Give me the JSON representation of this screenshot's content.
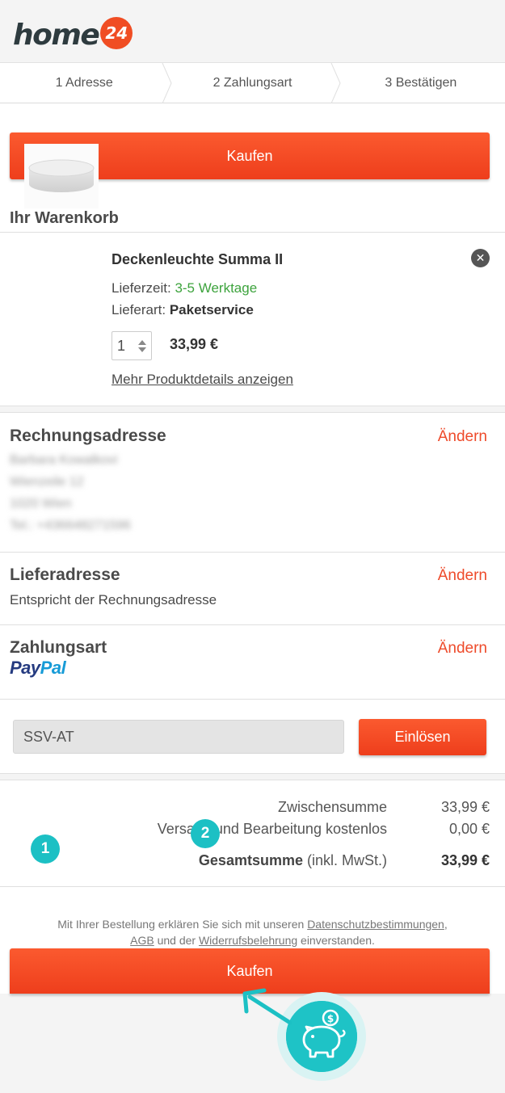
{
  "header": {
    "logo_text": "home",
    "logo_badge": "24"
  },
  "steps": [
    {
      "label": "1 Adresse"
    },
    {
      "label": "2 Zahlungsart"
    },
    {
      "label": "3 Bestätigen"
    }
  ],
  "buy_button_top": "Kaufen",
  "cart": {
    "title": "Ihr Warenkorb",
    "product_name": "Deckenleuchte Summa II",
    "delivery_time_label": "Lieferzeit:",
    "delivery_time_value": "3-5 Werktage",
    "delivery_type_label": "Lieferart:",
    "delivery_type_value": "Paketservice",
    "quantity": "1",
    "price": "33,99 €",
    "details_link": "Mehr Produktdetails anzeigen"
  },
  "billing": {
    "title": "Rechnungsadresse",
    "change_label": "Ändern",
    "lines": [
      "Barbara Kowalkovi",
      "Wienzeile 12",
      "1020 Wien",
      "Tel.: +436648271596"
    ]
  },
  "shipping": {
    "title": "Lieferadresse",
    "change_label": "Ändern",
    "text": "Entspricht der Rechnungsadresse"
  },
  "payment": {
    "title": "Zahlungsart",
    "change_label": "Ändern",
    "method_part1": "Pay",
    "method_part2": "Pal"
  },
  "voucher": {
    "value": "SSV-AT",
    "button_label": "Einlösen"
  },
  "summary": {
    "subtotal_label": "Zwischensumme",
    "subtotal_value": "33,99 €",
    "shipping_label": "Versand und Bearbeitung kostenlos",
    "shipping_value": "0,00 €",
    "total_label": "Gesamtsumme",
    "total_note": "(inkl. MwSt.)",
    "total_value": "33,99 €"
  },
  "markers": [
    "1",
    "2"
  ],
  "legal": {
    "part1": "Mit Ihrer Bestellung erklären Sie sich mit unseren ",
    "privacy_link": "Datenschutzbestimmungen",
    "part2": ",",
    "agb_link": "AGB",
    "part3": " und der ",
    "withdrawal_link": "Widerrufsbelehrung",
    "part4": " einverstanden."
  },
  "buy_button_bottom": "Kaufen",
  "colors": {
    "accent": "#ee4b2b",
    "green": "#3da33d",
    "teal": "#1cc0c4"
  }
}
